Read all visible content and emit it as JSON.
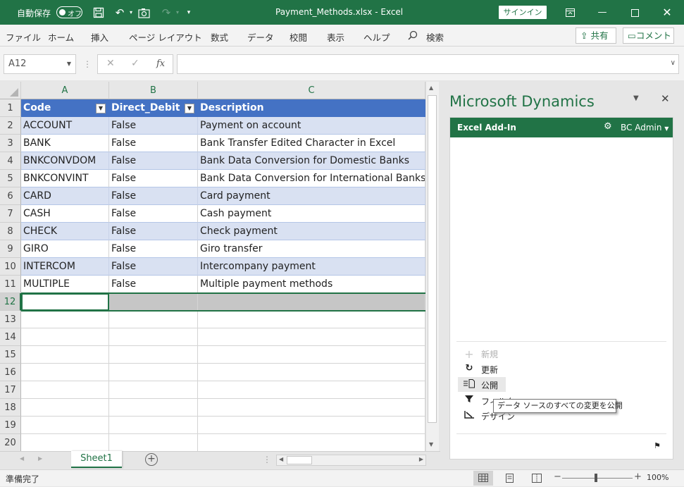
{
  "titlebar": {
    "autosave_label": "自動保存",
    "autosave_state": "オフ",
    "file_title": "Payment_Methods.xlsx  -  Excel",
    "signin_label": "サインイン",
    "accent_color": "#217346"
  },
  "ribbon": {
    "tabs": [
      "ファイル",
      "ホーム",
      "挿入",
      "ページ レイアウト",
      "数式",
      "データ",
      "校閲",
      "表示",
      "ヘルプ"
    ],
    "search_label": "検索",
    "share_label": "共有",
    "comment_label": "コメント"
  },
  "formula_bar": {
    "name_box": "A12",
    "fx_label": "fx",
    "formula": ""
  },
  "sheet": {
    "col_headers": [
      "A",
      "B",
      "C"
    ],
    "row_numbers": [
      "1",
      "2",
      "3",
      "4",
      "5",
      "6",
      "7",
      "8",
      "9",
      "10",
      "11",
      "12",
      "13",
      "14",
      "15",
      "16",
      "17",
      "18",
      "19",
      "20"
    ],
    "table_headers": [
      "Code",
      "Direct_Debit",
      "Description"
    ],
    "rows": [
      [
        "ACCOUNT",
        "False",
        "Payment on account"
      ],
      [
        "BANK",
        "False",
        "Bank Transfer Edited Character in Excel"
      ],
      [
        "BNKCONVDOM",
        "False",
        "Bank Data Conversion for Domestic Banks"
      ],
      [
        "BNKCONVINT",
        "False",
        "Bank Data Conversion for International Banks"
      ],
      [
        "CARD",
        "False",
        "Card payment"
      ],
      [
        "CASH",
        "False",
        "Cash payment"
      ],
      [
        "CHECK",
        "False",
        "Check payment"
      ],
      [
        "GIRO",
        "False",
        "Giro transfer"
      ],
      [
        "INTERCOM",
        "False",
        "Intercompany payment"
      ],
      [
        "MULTIPLE",
        "False",
        "Multiple payment methods"
      ]
    ],
    "table_header_color": "#4472c4",
    "band_color": "#d9e1f2"
  },
  "tabs": {
    "sheet_name": "Sheet1"
  },
  "status": {
    "ready": "準備完了",
    "zoom": "100%"
  },
  "pane": {
    "title": "Microsoft Dynamics",
    "addin_label": "Excel Add-In",
    "user": "BC Admin",
    "actions": [
      "新規",
      "更新",
      "公開",
      "フィルター",
      "デザイン"
    ],
    "tooltip": "データ ソースのすべての変更を公開"
  }
}
